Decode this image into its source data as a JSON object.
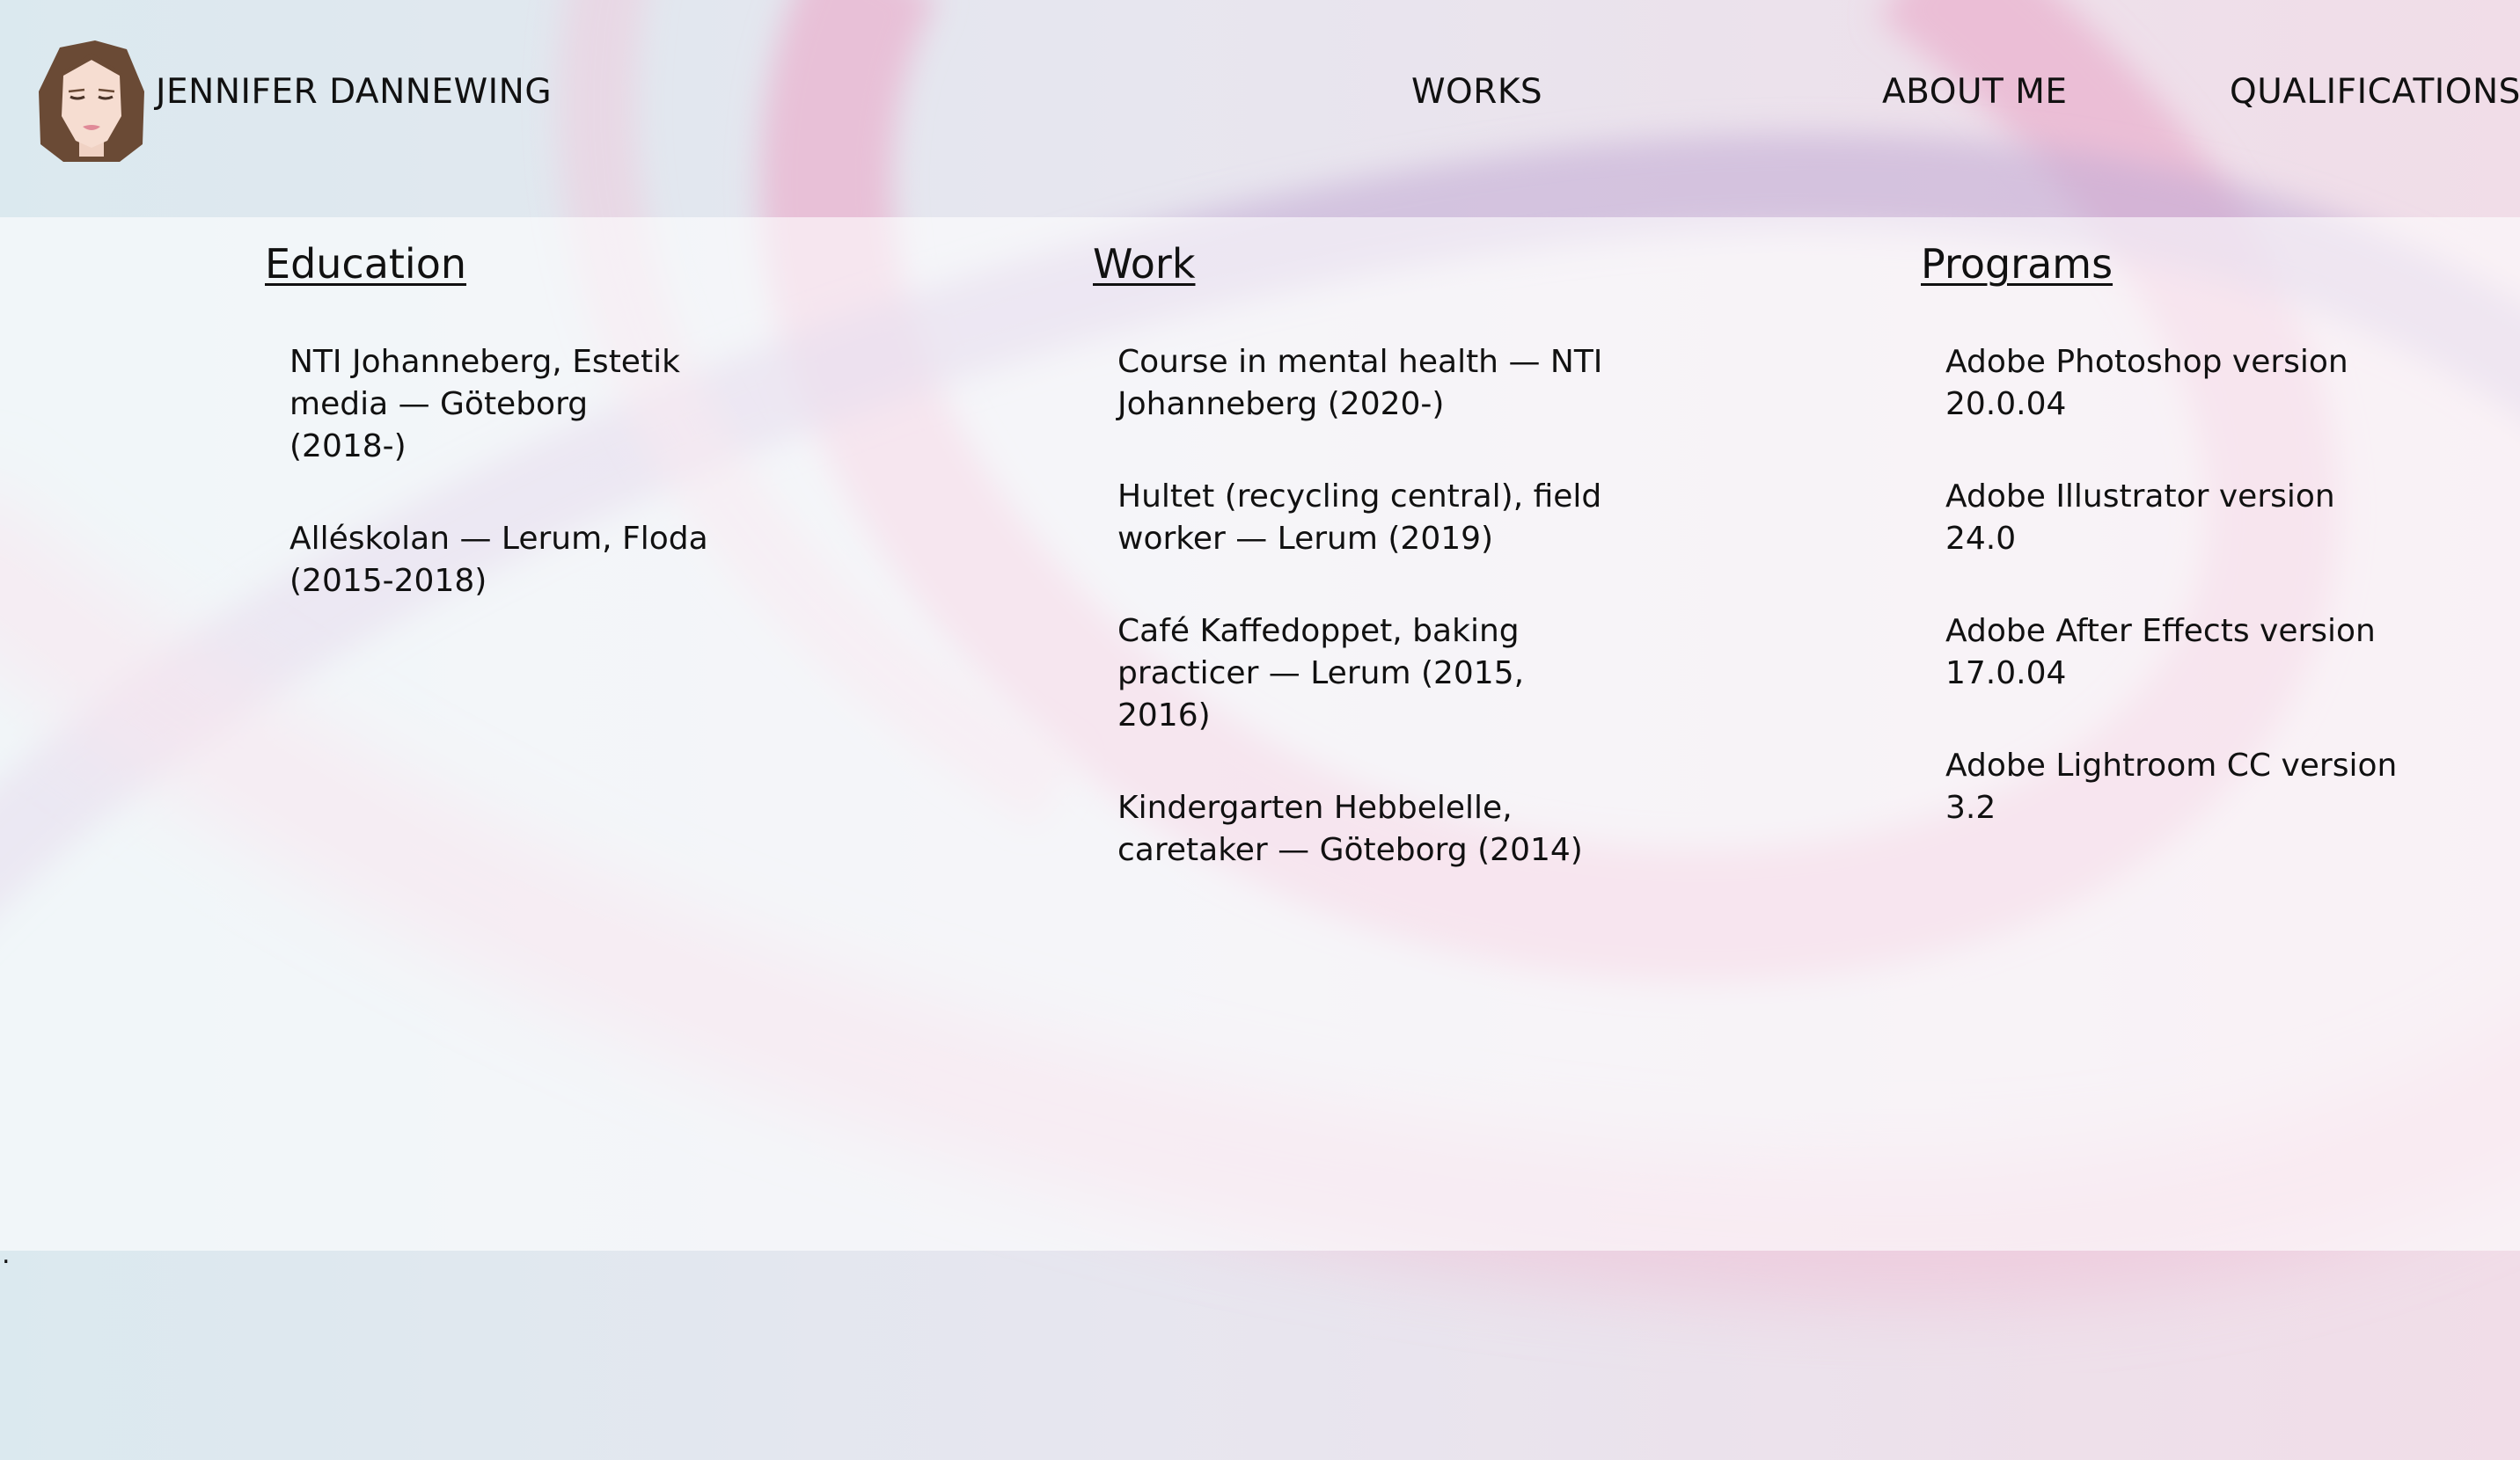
{
  "header": {
    "site_name": "JENNIFER DANNEWING",
    "nav": {
      "works": "WORKS",
      "about": "ABOUT ME",
      "qualifications": "QUALIFICATIONS"
    }
  },
  "columns": {
    "education": {
      "title": "Education",
      "items": [
        "NTI Johanneberg, Estetik media — Göteborg (2018-)",
        "Alléskolan — Lerum, Floda (2015-2018)"
      ]
    },
    "work": {
      "title": "Work",
      "items": [
        "Course in mental health — NTI Johanneberg (2020-)",
        "Hultet (recycling central), field worker — Lerum (2019)",
        "Café Kaffedoppet, baking practicer — Lerum (2015, 2016)",
        "Kindergarten Hebbelelle, caretaker — Göteborg (2014)"
      ]
    },
    "programs": {
      "title": "Programs",
      "items": [
        "Adobe Photoshop version 20.0.04",
        "Adobe Illustrator version 24.0",
        "Adobe After Effects version 17.0.04",
        "Adobe Lightroom CC version 3.2"
      ]
    }
  },
  "footer": {
    "text": "."
  },
  "colors": {
    "background_blue": "#dceaf0",
    "accent_pink": "#e9b7d0",
    "accent_purple": "#c9b4d8",
    "text": "#111111"
  },
  "icons": {
    "logo": "woman-portrait-icon"
  }
}
